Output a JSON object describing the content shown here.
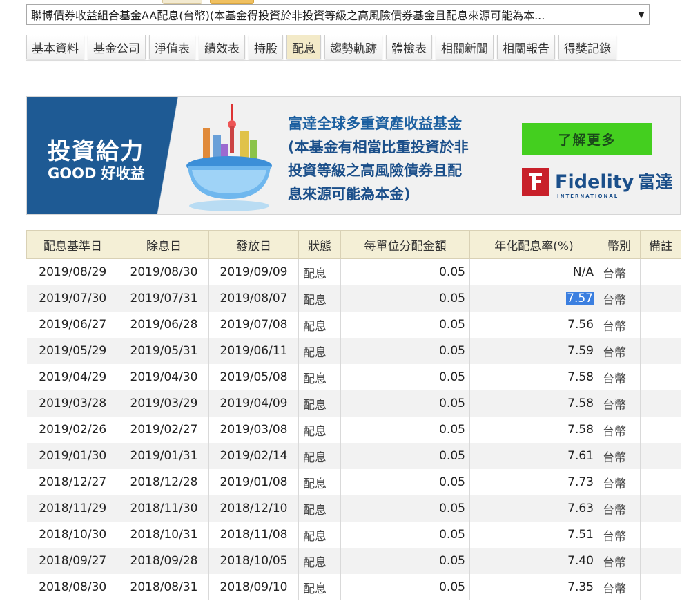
{
  "fund_select": {
    "selected": "聯博債券收益組合基金AA配息(台幣)(本基金得投資於非投資等級之高風險債券基金且配息來源可能為本..."
  },
  "tabs": [
    {
      "label": "基本資料",
      "active": false
    },
    {
      "label": "基金公司",
      "active": false
    },
    {
      "label": "淨值表",
      "active": false
    },
    {
      "label": "績效表",
      "active": false
    },
    {
      "label": "持股",
      "active": false
    },
    {
      "label": "配息",
      "active": true
    },
    {
      "label": "趨勢軌跡",
      "active": false
    },
    {
      "label": "體檢表",
      "active": false
    },
    {
      "label": "相關新聞",
      "active": false
    },
    {
      "label": "相關報告",
      "active": false
    },
    {
      "label": "得獎記錄",
      "active": false
    }
  ],
  "banner": {
    "title": "投資給力",
    "subtitle": "GOOD 好收益",
    "fund_name": "富達全球多重資產收益基金",
    "disclaimer_line1": "(本基金有相當比重投資於非",
    "disclaimer_line2": "投資等級之高風險債券且配",
    "disclaimer_line3": "息來源可能為本金)",
    "button": "了解更多",
    "brand": "Fidelity",
    "brand_cn": "富達",
    "brand_sub": "INTERNATIONAL",
    "colors": {
      "panel": "#1e5a94",
      "button": "#44cf1f",
      "logo": "#c8202a"
    }
  },
  "table": {
    "headers": [
      "配息基準日",
      "除息日",
      "發放日",
      "狀態",
      "每單位分配金額",
      "年化配息率(%)",
      "幣別",
      "備註"
    ],
    "rows": [
      [
        "2019/08/29",
        "2019/08/30",
        "2019/09/09",
        "配息",
        "0.05",
        "N/A",
        "台幣",
        ""
      ],
      [
        "2019/07/30",
        "2019/07/31",
        "2019/08/07",
        "配息",
        "0.05",
        "7.57",
        "台幣",
        ""
      ],
      [
        "2019/06/27",
        "2019/06/28",
        "2019/07/08",
        "配息",
        "0.05",
        "7.56",
        "台幣",
        ""
      ],
      [
        "2019/05/29",
        "2019/05/31",
        "2019/06/11",
        "配息",
        "0.05",
        "7.59",
        "台幣",
        ""
      ],
      [
        "2019/04/29",
        "2019/04/30",
        "2019/05/08",
        "配息",
        "0.05",
        "7.58",
        "台幣",
        ""
      ],
      [
        "2019/03/28",
        "2019/03/29",
        "2019/04/09",
        "配息",
        "0.05",
        "7.58",
        "台幣",
        ""
      ],
      [
        "2019/02/26",
        "2019/02/27",
        "2019/03/08",
        "配息",
        "0.05",
        "7.58",
        "台幣",
        ""
      ],
      [
        "2019/01/30",
        "2019/01/31",
        "2019/02/14",
        "配息",
        "0.05",
        "7.61",
        "台幣",
        ""
      ],
      [
        "2018/12/27",
        "2018/12/28",
        "2019/01/08",
        "配息",
        "0.05",
        "7.73",
        "台幣",
        ""
      ],
      [
        "2018/11/29",
        "2018/11/30",
        "2018/12/10",
        "配息",
        "0.05",
        "7.63",
        "台幣",
        ""
      ],
      [
        "2018/10/30",
        "2018/10/31",
        "2018/11/08",
        "配息",
        "0.05",
        "7.51",
        "台幣",
        ""
      ],
      [
        "2018/09/27",
        "2018/09/28",
        "2018/10/05",
        "配息",
        "0.05",
        "7.40",
        "台幣",
        ""
      ],
      [
        "2018/08/30",
        "2018/08/31",
        "2018/09/10",
        "配息",
        "0.05",
        "7.35",
        "台幣",
        ""
      ]
    ],
    "highlighted": {
      "row": 1,
      "col": 5
    }
  }
}
